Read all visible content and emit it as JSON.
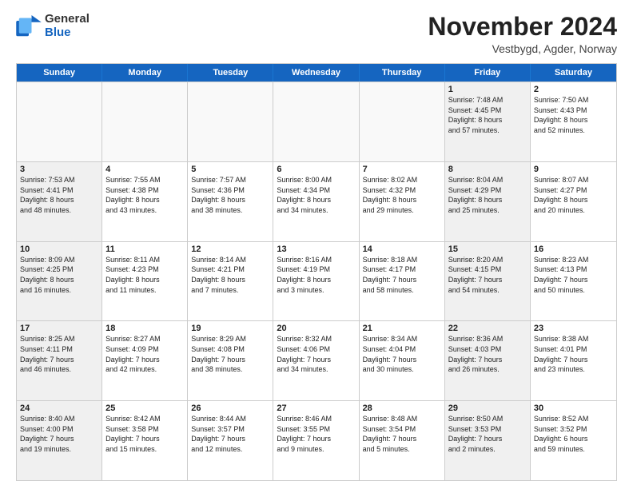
{
  "logo": {
    "general": "General",
    "blue": "Blue"
  },
  "title": "November 2024",
  "location": "Vestbygd, Agder, Norway",
  "header_days": [
    "Sunday",
    "Monday",
    "Tuesday",
    "Wednesday",
    "Thursday",
    "Friday",
    "Saturday"
  ],
  "rows": [
    [
      {
        "day": "",
        "info": "",
        "empty": true
      },
      {
        "day": "",
        "info": "",
        "empty": true
      },
      {
        "day": "",
        "info": "",
        "empty": true
      },
      {
        "day": "",
        "info": "",
        "empty": true
      },
      {
        "day": "",
        "info": "",
        "empty": true
      },
      {
        "day": "1",
        "info": "Sunrise: 7:48 AM\nSunset: 4:45 PM\nDaylight: 8 hours\nand 57 minutes.",
        "shaded": true
      },
      {
        "day": "2",
        "info": "Sunrise: 7:50 AM\nSunset: 4:43 PM\nDaylight: 8 hours\nand 52 minutes."
      }
    ],
    [
      {
        "day": "3",
        "info": "Sunrise: 7:53 AM\nSunset: 4:41 PM\nDaylight: 8 hours\nand 48 minutes.",
        "shaded": true
      },
      {
        "day": "4",
        "info": "Sunrise: 7:55 AM\nSunset: 4:38 PM\nDaylight: 8 hours\nand 43 minutes."
      },
      {
        "day": "5",
        "info": "Sunrise: 7:57 AM\nSunset: 4:36 PM\nDaylight: 8 hours\nand 38 minutes."
      },
      {
        "day": "6",
        "info": "Sunrise: 8:00 AM\nSunset: 4:34 PM\nDaylight: 8 hours\nand 34 minutes."
      },
      {
        "day": "7",
        "info": "Sunrise: 8:02 AM\nSunset: 4:32 PM\nDaylight: 8 hours\nand 29 minutes."
      },
      {
        "day": "8",
        "info": "Sunrise: 8:04 AM\nSunset: 4:29 PM\nDaylight: 8 hours\nand 25 minutes.",
        "shaded": true
      },
      {
        "day": "9",
        "info": "Sunrise: 8:07 AM\nSunset: 4:27 PM\nDaylight: 8 hours\nand 20 minutes."
      }
    ],
    [
      {
        "day": "10",
        "info": "Sunrise: 8:09 AM\nSunset: 4:25 PM\nDaylight: 8 hours\nand 16 minutes.",
        "shaded": true
      },
      {
        "day": "11",
        "info": "Sunrise: 8:11 AM\nSunset: 4:23 PM\nDaylight: 8 hours\nand 11 minutes."
      },
      {
        "day": "12",
        "info": "Sunrise: 8:14 AM\nSunset: 4:21 PM\nDaylight: 8 hours\nand 7 minutes."
      },
      {
        "day": "13",
        "info": "Sunrise: 8:16 AM\nSunset: 4:19 PM\nDaylight: 8 hours\nand 3 minutes."
      },
      {
        "day": "14",
        "info": "Sunrise: 8:18 AM\nSunset: 4:17 PM\nDaylight: 7 hours\nand 58 minutes."
      },
      {
        "day": "15",
        "info": "Sunrise: 8:20 AM\nSunset: 4:15 PM\nDaylight: 7 hours\nand 54 minutes.",
        "shaded": true
      },
      {
        "day": "16",
        "info": "Sunrise: 8:23 AM\nSunset: 4:13 PM\nDaylight: 7 hours\nand 50 minutes."
      }
    ],
    [
      {
        "day": "17",
        "info": "Sunrise: 8:25 AM\nSunset: 4:11 PM\nDaylight: 7 hours\nand 46 minutes.",
        "shaded": true
      },
      {
        "day": "18",
        "info": "Sunrise: 8:27 AM\nSunset: 4:09 PM\nDaylight: 7 hours\nand 42 minutes."
      },
      {
        "day": "19",
        "info": "Sunrise: 8:29 AM\nSunset: 4:08 PM\nDaylight: 7 hours\nand 38 minutes."
      },
      {
        "day": "20",
        "info": "Sunrise: 8:32 AM\nSunset: 4:06 PM\nDaylight: 7 hours\nand 34 minutes."
      },
      {
        "day": "21",
        "info": "Sunrise: 8:34 AM\nSunset: 4:04 PM\nDaylight: 7 hours\nand 30 minutes."
      },
      {
        "day": "22",
        "info": "Sunrise: 8:36 AM\nSunset: 4:03 PM\nDaylight: 7 hours\nand 26 minutes.",
        "shaded": true
      },
      {
        "day": "23",
        "info": "Sunrise: 8:38 AM\nSunset: 4:01 PM\nDaylight: 7 hours\nand 23 minutes."
      }
    ],
    [
      {
        "day": "24",
        "info": "Sunrise: 8:40 AM\nSunset: 4:00 PM\nDaylight: 7 hours\nand 19 minutes.",
        "shaded": true
      },
      {
        "day": "25",
        "info": "Sunrise: 8:42 AM\nSunset: 3:58 PM\nDaylight: 7 hours\nand 15 minutes."
      },
      {
        "day": "26",
        "info": "Sunrise: 8:44 AM\nSunset: 3:57 PM\nDaylight: 7 hours\nand 12 minutes."
      },
      {
        "day": "27",
        "info": "Sunrise: 8:46 AM\nSunset: 3:55 PM\nDaylight: 7 hours\nand 9 minutes."
      },
      {
        "day": "28",
        "info": "Sunrise: 8:48 AM\nSunset: 3:54 PM\nDaylight: 7 hours\nand 5 minutes."
      },
      {
        "day": "29",
        "info": "Sunrise: 8:50 AM\nSunset: 3:53 PM\nDaylight: 7 hours\nand 2 minutes.",
        "shaded": true
      },
      {
        "day": "30",
        "info": "Sunrise: 8:52 AM\nSunset: 3:52 PM\nDaylight: 6 hours\nand 59 minutes."
      }
    ]
  ]
}
